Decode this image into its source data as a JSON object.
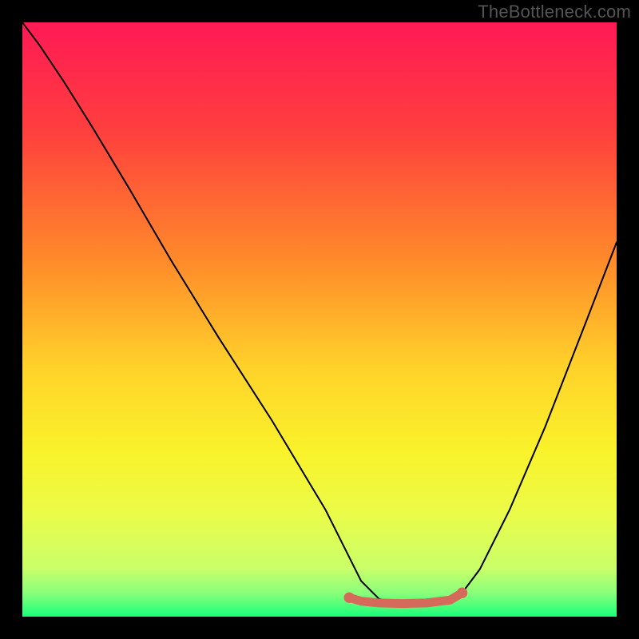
{
  "watermark": "TheBottleneck.com",
  "chart_data": {
    "type": "line",
    "title": "",
    "xlabel": "",
    "ylabel": "",
    "xlim": [
      0,
      100
    ],
    "ylim": [
      0,
      100
    ],
    "gradient_stops": [
      {
        "offset": 0,
        "color": "#ff1a55"
      },
      {
        "offset": 18,
        "color": "#ff3e3e"
      },
      {
        "offset": 40,
        "color": "#ff8a2a"
      },
      {
        "offset": 58,
        "color": "#ffd22a"
      },
      {
        "offset": 72,
        "color": "#faf22a"
      },
      {
        "offset": 83,
        "color": "#eafc4a"
      },
      {
        "offset": 92,
        "color": "#c8ff6a"
      },
      {
        "offset": 96,
        "color": "#8aff7a"
      },
      {
        "offset": 100,
        "color": "#1aff7a"
      }
    ],
    "series": [
      {
        "name": "main-curve",
        "color": "#000000",
        "x": [
          0,
          3,
          7,
          12,
          18,
          25,
          33,
          42,
          51,
          55,
          57,
          60,
          64,
          68,
          72,
          74,
          77,
          82,
          88,
          95,
          100
        ],
        "y": [
          100,
          96,
          90,
          82,
          72,
          60,
          47,
          33,
          18,
          10,
          6,
          3,
          2,
          2,
          3,
          4,
          8,
          18,
          32,
          50,
          63
        ]
      },
      {
        "name": "highlight-segment",
        "color": "#d56a5a",
        "x": [
          55,
          57,
          60,
          64,
          68,
          72,
          74
        ],
        "y": [
          3.2,
          2.6,
          2.3,
          2.2,
          2.3,
          2.8,
          4.0
        ]
      }
    ],
    "highlight_endpoints": [
      {
        "x": 55,
        "y": 3.2
      },
      {
        "x": 74,
        "y": 4.0
      }
    ]
  }
}
